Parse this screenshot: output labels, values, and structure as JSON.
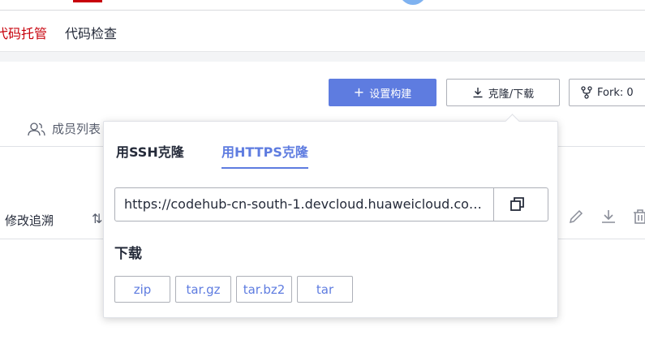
{
  "nav": {
    "tabs": [
      "代码托管",
      "代码检查"
    ]
  },
  "actions": {
    "build_label": "设置构建",
    "clone_label": "克隆/下载",
    "fork_label": "Fork: 0"
  },
  "members_label": "成员列表",
  "toolbar": {
    "trace_label": "修改追溯"
  },
  "clone_popover": {
    "tabs": [
      "用SSH克隆",
      "用HTTPS克隆"
    ],
    "active_tab": "用HTTPS克隆",
    "url": "https://codehub-cn-south-1.devcloud.huaweicloud.com...",
    "download_title": "下载",
    "download_formats": [
      "zip",
      "tar.gz",
      "tar.bz2",
      "tar"
    ]
  },
  "colors": {
    "brand_red": "#c7000b",
    "primary": "#5e7ce0"
  }
}
